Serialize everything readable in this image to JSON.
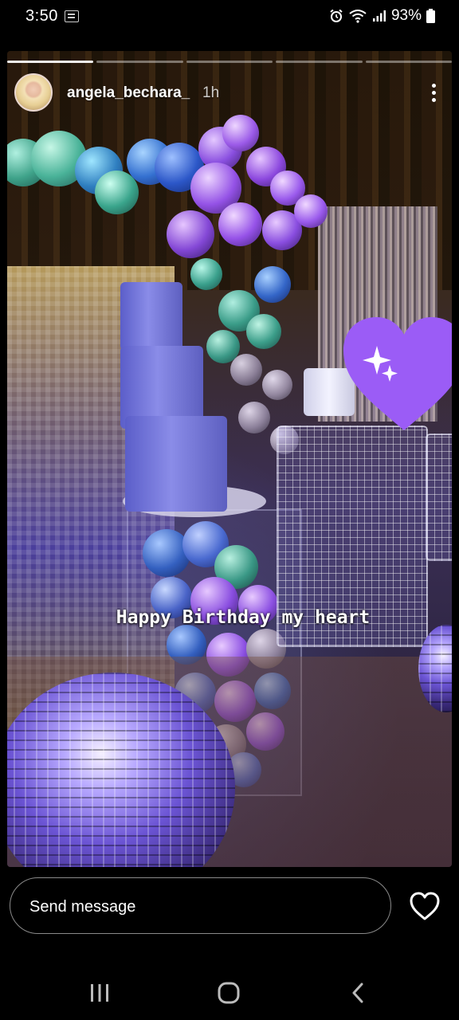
{
  "status_bar": {
    "time": "3:50",
    "battery": "93%",
    "icons": [
      "gallery-notification-icon",
      "alarm-icon",
      "wifi-icon",
      "signal-icon",
      "battery-icon"
    ]
  },
  "story": {
    "progress": {
      "segments": 5,
      "current": 1
    },
    "username": "angela_bechara_",
    "time_ago": "1h",
    "caption": "Happy Birthday my heart",
    "sticker": "purple-heart-sparkles"
  },
  "footer": {
    "message_placeholder": "Send message",
    "like_icon": "heart-outline-icon"
  },
  "nav_bar": {
    "icons": [
      "recent-apps-icon",
      "home-icon",
      "back-icon"
    ]
  },
  "colors": {
    "accent_purple": "#9b5cf6",
    "background": "#000000"
  }
}
